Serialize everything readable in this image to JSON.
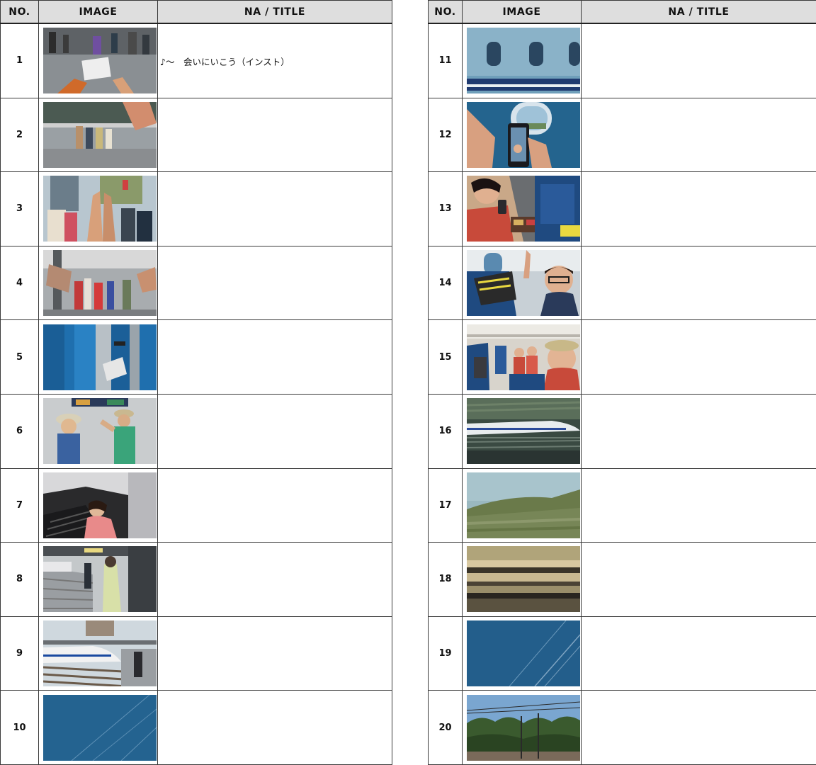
{
  "headers": {
    "no": "NO.",
    "image": "IMAGE",
    "na_title": "NA / TITLE"
  },
  "left_rows": [
    {
      "no": "1",
      "na": "♪～　会いにいこう（インスト）",
      "scene": "station-concourse-hand-holding-ticket"
    },
    {
      "no": "2",
      "na": "",
      "scene": "friends-waving-at-station-entrance"
    },
    {
      "no": "3",
      "na": "",
      "scene": "high-five-in-front-of-station"
    },
    {
      "no": "4",
      "na": "",
      "scene": "group-greeting-at-station"
    },
    {
      "no": "5",
      "na": "",
      "scene": "ticket-gate-blue"
    },
    {
      "no": "6",
      "na": "",
      "scene": "two-women-in-hats-concourse"
    },
    {
      "no": "7",
      "na": "",
      "scene": "woman-on-escalator"
    },
    {
      "no": "8",
      "na": "",
      "scene": "platform-stairs"
    },
    {
      "no": "9",
      "na": "",
      "scene": "shinkansen-at-platform"
    },
    {
      "no": "10",
      "na": "",
      "scene": "blue-window-blur"
    }
  ],
  "right_rows": [
    {
      "no": "11",
      "na": "",
      "scene": "train-side-windows-blur"
    },
    {
      "no": "12",
      "na": "",
      "scene": "phone-photo-at-window"
    },
    {
      "no": "13",
      "na": "",
      "scene": "woman-with-bento-on-train"
    },
    {
      "no": "14",
      "na": "",
      "scene": "cheering-friends-on-train"
    },
    {
      "no": "15",
      "na": "",
      "scene": "group-selfie-in-train-car"
    },
    {
      "no": "16",
      "na": "",
      "scene": "shinkansen-passing-motion"
    },
    {
      "no": "17",
      "na": "",
      "scene": "green-landscape-blur"
    },
    {
      "no": "18",
      "na": "",
      "scene": "motion-blur-lines"
    },
    {
      "no": "19",
      "na": "",
      "scene": "blue-window-streaks"
    },
    {
      "no": "20",
      "na": "",
      "scene": "trees-and-overhead-wires"
    }
  ]
}
